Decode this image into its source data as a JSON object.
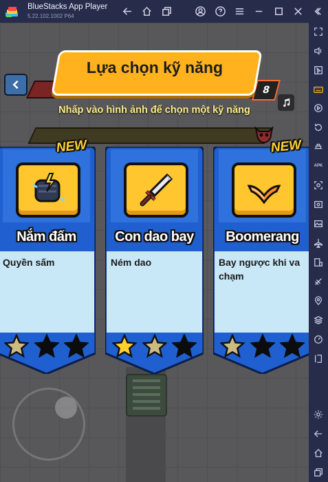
{
  "window": {
    "app_name": "BlueStacks App Player",
    "version": "5.22.102.1002  P64"
  },
  "sidebar": {
    "apk_label": "APK"
  },
  "game": {
    "title": "Lựa chọn kỹ năng",
    "subtitle": "Nhấp vào hình ảnh để chọn một kỹ năng",
    "level": "8",
    "new_label": "NEW",
    "cards": [
      {
        "name": "Nắm đấm",
        "description": "Quyền sấm",
        "stars_filled": 1,
        "stars_total": 3,
        "new": true
      },
      {
        "name": "Con dao bay",
        "description": "Ném dao",
        "stars_filled": 2,
        "stars_total": 3,
        "new": false
      },
      {
        "name": "Boomerang",
        "description": "Bay ngược khi va chạm",
        "stars_filled": 1,
        "stars_total": 3,
        "new": true
      }
    ]
  },
  "colors": {
    "card_blue": "#1f5fd0",
    "banner_orange": "#ffb21e",
    "desc_bg": "#c9e8f7",
    "star_gold": "#ffd02e"
  }
}
